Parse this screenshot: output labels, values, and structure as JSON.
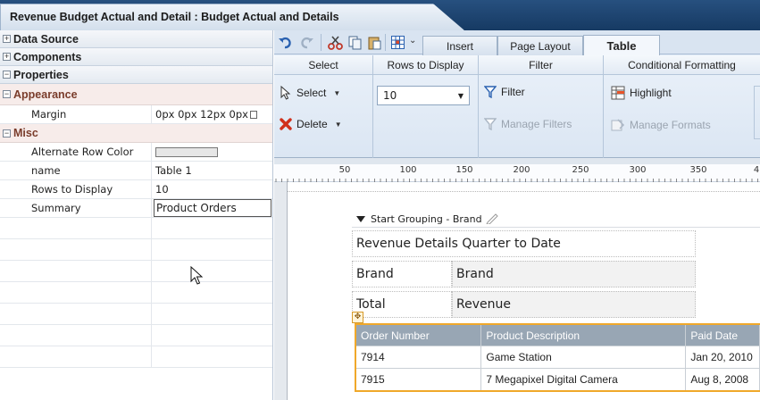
{
  "window": {
    "title": "Revenue Budget Actual and Detail : Budget Actual and Details"
  },
  "left_panel": {
    "sections": [
      {
        "label": "Data Source",
        "toggle": "+"
      },
      {
        "label": "Components",
        "toggle": "+"
      },
      {
        "label": "Properties",
        "toggle": "−"
      }
    ],
    "appearance": {
      "label": "Appearance",
      "toggle": "−",
      "rows": [
        {
          "key": "Margin",
          "value": "0px 0px 12px 0px"
        }
      ]
    },
    "misc": {
      "label": "Misc",
      "toggle": "−",
      "rows": [
        {
          "key": "Alternate Row Color",
          "value": "",
          "swatch": "#e6e6e6"
        },
        {
          "key": "name",
          "value": "Table 1"
        },
        {
          "key": "Rows to Display",
          "value": "10"
        },
        {
          "key": "Summary",
          "value": "Product Orders"
        }
      ]
    }
  },
  "ribbon": {
    "tabs": [
      {
        "label": "Insert",
        "active": false
      },
      {
        "label": "Page Layout",
        "active": false
      },
      {
        "label": "Table",
        "active": true
      }
    ],
    "groups": {
      "select": {
        "header": "Select",
        "select_label": "Select",
        "delete_label": "Delete"
      },
      "rows": {
        "header": "Rows to Display",
        "value": "10"
      },
      "filter": {
        "header": "Filter",
        "filter_label": "Filter",
        "manage_label": "Manage Filters"
      },
      "conditional": {
        "header": "Conditional Formatting",
        "highlight_label": "Highlight",
        "manage_label": "Manage Formats"
      }
    }
  },
  "ruler": {
    "labels": [
      "50",
      "100",
      "150",
      "200",
      "250",
      "300",
      "350",
      "4"
    ]
  },
  "canvas": {
    "grouping": "Start Grouping - Brand",
    "summary_rows": [
      {
        "label": "Revenue Details Quarter to Date",
        "value": ""
      },
      {
        "label": "Brand",
        "value": "Brand"
      },
      {
        "label": "Total",
        "value": "Revenue"
      }
    ],
    "table": {
      "columns": [
        "Order Number",
        "Product Description",
        "Paid Date"
      ],
      "rows": [
        [
          "7914",
          "Game Station",
          "Jan 20, 2010"
        ],
        [
          "7915",
          "7 Megapixel Digital Camera",
          "Aug 8, 2008"
        ]
      ]
    }
  },
  "colors": {
    "title_bar": "#1f4773",
    "appearance_text": "#7a3c2b",
    "selection_border": "#f0a82a",
    "table_header": "#98a6b4"
  }
}
